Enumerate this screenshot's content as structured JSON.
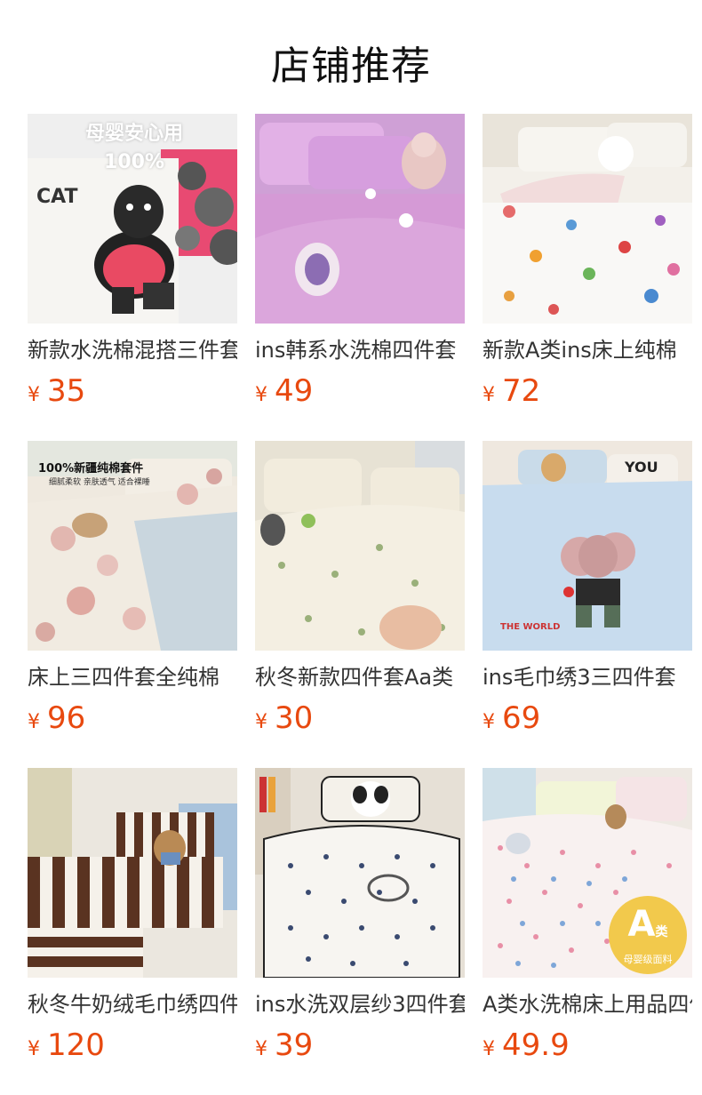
{
  "section_title": "店铺推荐",
  "currency": "¥",
  "products": [
    {
      "name": "新款水洗棉混搭三件套",
      "price": "35",
      "image_text": [
        "母婴安心用",
        "100%"
      ],
      "icon": "bedding-cat-photo"
    },
    {
      "name": "ins韩系水洗棉四件套",
      "price": "49",
      "image_text": [],
      "icon": "bedding-pink-photo"
    },
    {
      "name": "新款A类ins床上纯棉",
      "price": "72",
      "image_text": [],
      "icon": "bedding-white-flowers-photo"
    },
    {
      "name": "床上三四件套全纯棉",
      "price": "96",
      "image_text": [
        "100%新疆纯棉套件",
        "细腻柔软 亲肤透气 适合裸睡"
      ],
      "icon": "bedding-floral-photo"
    },
    {
      "name": "秋冬新款四件套Aa类",
      "price": "30",
      "image_text": [],
      "icon": "bedding-cream-floral-photo"
    },
    {
      "name": "ins毛巾绣3三四件套",
      "price": "69",
      "image_text": [],
      "icon": "bedding-blue-mouse-photo"
    },
    {
      "name": "秋冬牛奶绒毛巾绣四件",
      "price": "120",
      "image_text": [],
      "icon": "bedding-stripe-photo"
    },
    {
      "name": "ins水洗双层纱3四件套",
      "price": "39",
      "image_text": [],
      "icon": "bedding-bow-photo"
    },
    {
      "name": "A类水洗棉床上用品四件",
      "price": "49.9",
      "image_text": [
        "A",
        "类",
        "母婴级面料"
      ],
      "icon": "bedding-dots-photo"
    }
  ]
}
